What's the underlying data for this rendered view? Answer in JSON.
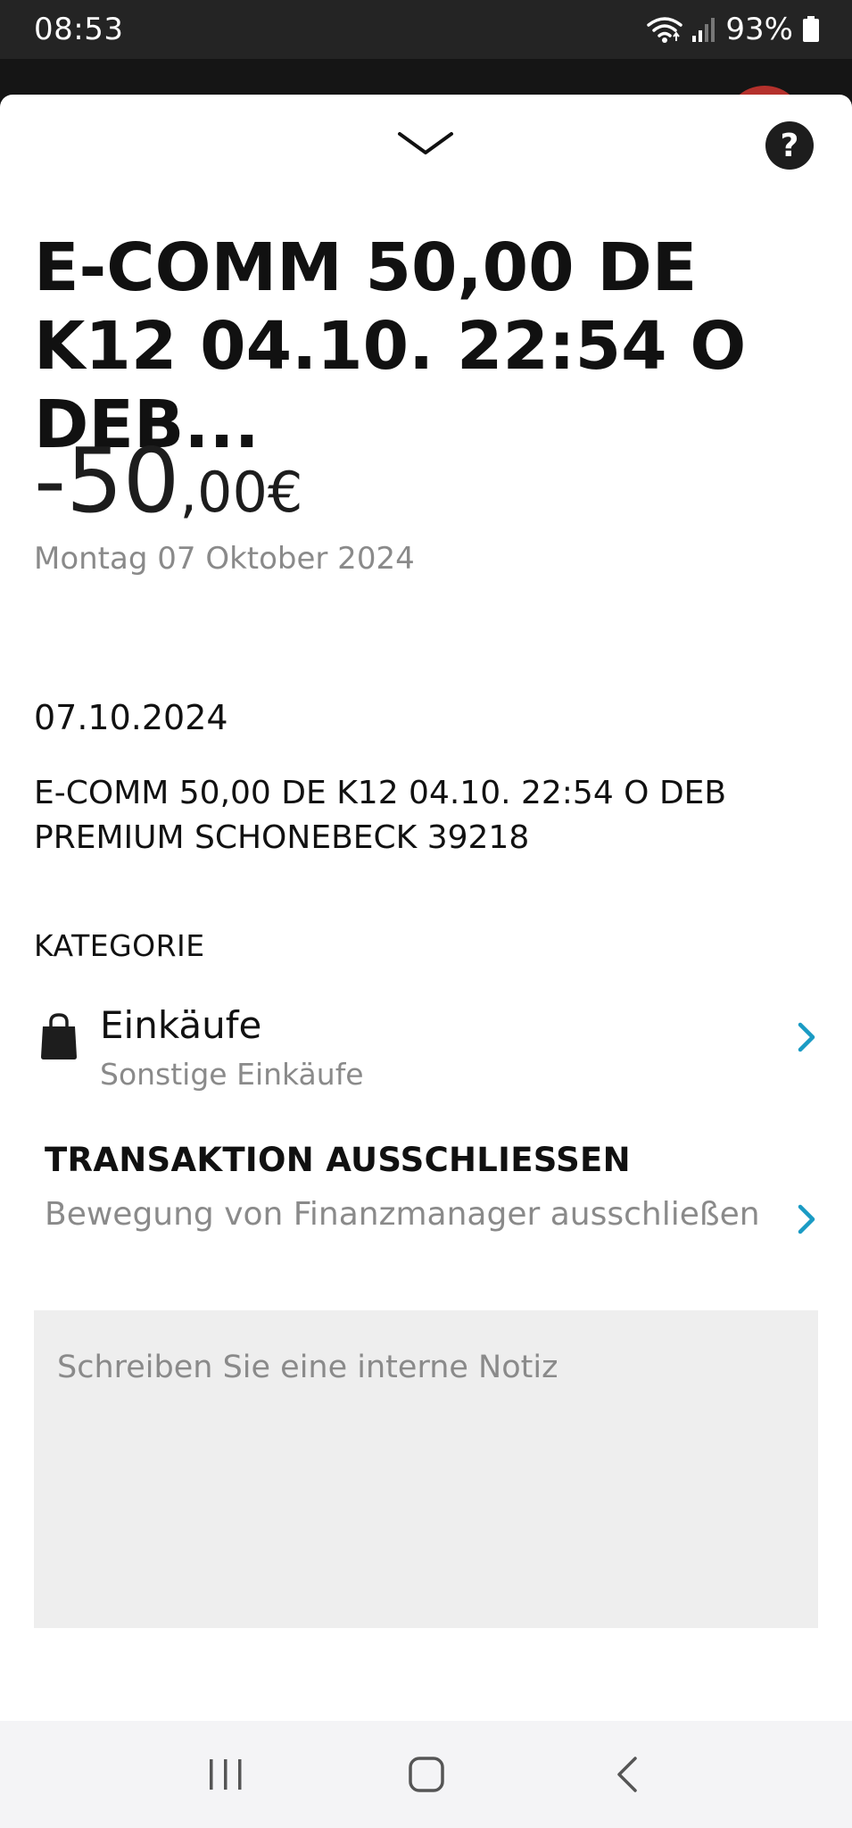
{
  "status_bar": {
    "time": "08:53",
    "battery": "93%"
  },
  "transaction": {
    "title": "E-COMM 50,00 DE K12 04.10. 22:54 O DEB...",
    "amount_main": "-50",
    "amount_decimal": ",00",
    "amount_currency": "€",
    "date_long": "Montag 07 Oktober 2024",
    "date_short": "07.10.2024",
    "description": "E-COMM 50,00 DE K12 04.10. 22:54 O DEB PREMIUM SCHONEBECK 39218"
  },
  "category": {
    "section_label": "KATEGORIE",
    "name": "Einkäufe",
    "subcategory": "Sonstige Einkäufe",
    "icon": "shopping-bag-icon"
  },
  "exclude": {
    "title": "TRANSAKTION AUSSCHLIESSEN",
    "subtitle": "Bewegung von Finanzmanager ausschließen"
  },
  "note": {
    "placeholder": "Schreiben Sie eine interne Notiz",
    "value": ""
  },
  "colors": {
    "accent": "#1a9bc4",
    "muted_text": "#8a8a8a",
    "note_background": "#eeeeee"
  }
}
